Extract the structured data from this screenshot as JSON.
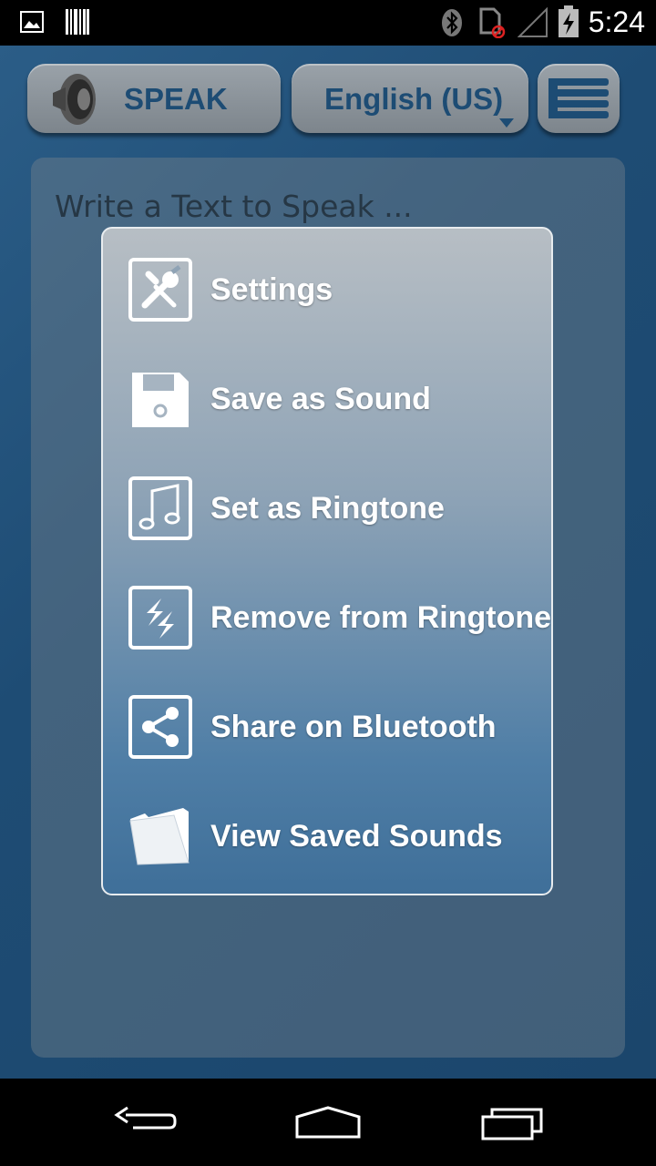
{
  "status_bar": {
    "time": "5:24",
    "icons": [
      "gallery-notification-icon",
      "barcode-notification-icon",
      "bluetooth-icon",
      "no-sim-icon",
      "signal-empty-icon",
      "battery-charging-icon"
    ]
  },
  "toolbar": {
    "speak_label": "SPEAK",
    "language_label": "English (US)"
  },
  "editor": {
    "placeholder": "Write a Text to Speak ..."
  },
  "menu": {
    "items": [
      {
        "label": "Settings",
        "icon": "wrench-screwdriver-icon"
      },
      {
        "label": "Save as Sound",
        "icon": "floppy-disk-icon"
      },
      {
        "label": "Set as Ringtone",
        "icon": "music-note-icon"
      },
      {
        "label": "Remove from Ringtone",
        "icon": "refresh-arrows-icon"
      },
      {
        "label": "Share on Bluetooth",
        "icon": "share-icon"
      },
      {
        "label": "View Saved Sounds",
        "icon": "folder-icon"
      }
    ]
  },
  "nav_bar": {
    "icons": [
      "back-icon",
      "home-icon",
      "recents-icon"
    ]
  },
  "colors": {
    "background": "#1f4f78",
    "button_text": "#1d4c74",
    "menu_text": "#ffffff"
  }
}
